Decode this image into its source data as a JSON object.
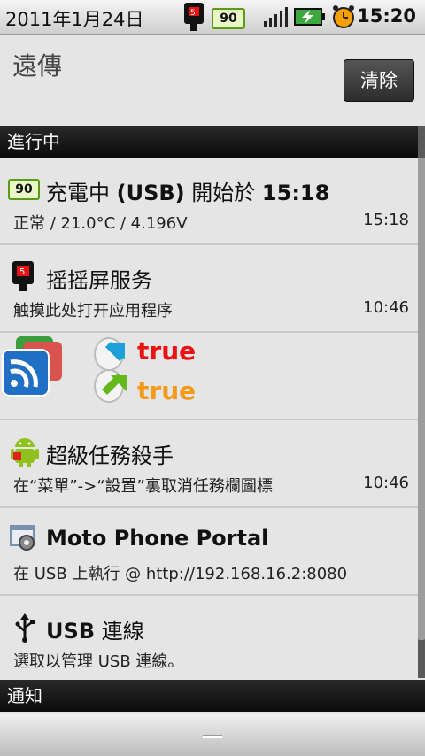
{
  "statusbar": {
    "date": "2011年1月24日",
    "battery_level": "90",
    "time": "15:20"
  },
  "header": {
    "title": "遠傳",
    "clear_label": "清除"
  },
  "sections": {
    "ongoing": "進行中",
    "notifications": "通知"
  },
  "items": [
    {
      "title_prefix": "充電中 ",
      "title_bold": "(USB)",
      "title_mid": " 開始於 ",
      "title_time": "15:18",
      "battery_badge": "90",
      "subtitle": "正常 / 21.0°C / 4.196V",
      "time": "15:18"
    },
    {
      "title": "摇摇屏服务",
      "subtitle": "触摸此处打开应用程序",
      "time": "10:46"
    },
    {
      "value1": "true",
      "value2": "true"
    },
    {
      "title": "超級任務殺手",
      "subtitle": "在“菜單”->“設置”裏取消任務欄圖標",
      "time": "10:46"
    },
    {
      "title": "Moto Phone Portal",
      "subtitle": "在 USB 上執行 @  http://192.168.16.2:8080"
    },
    {
      "title_bold": "USB",
      "title_rest": " 連線",
      "subtitle": "選取以管理 USB 連線。"
    }
  ],
  "colors": {
    "true_red": "#ee1111",
    "true_orange": "#f39a1a",
    "section_bg": "#111111",
    "background": "#e5e5e5"
  }
}
